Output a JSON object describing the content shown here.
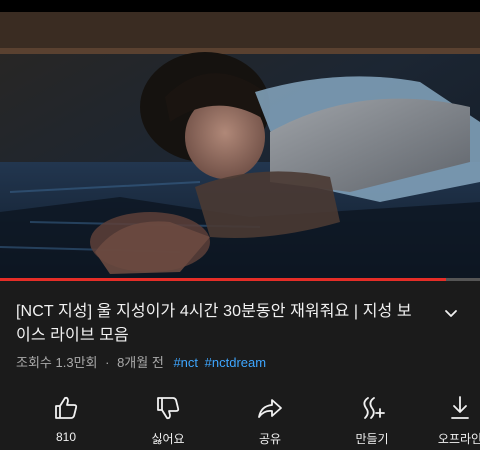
{
  "video": {
    "progress_fraction": 0.93
  },
  "title": "[NCT 지성] 울 지성이가 4시간 30분동안 재워줘요 | 지성 보이스 라이브 모음",
  "meta": {
    "views": "조회수 1.3만회",
    "separator": "·",
    "age": "8개월 전",
    "tags": [
      "#nct",
      "#nctdream"
    ]
  },
  "actions": [
    {
      "icon": "thumbs-up-icon",
      "label": "810"
    },
    {
      "icon": "thumbs-down-icon",
      "label": "싫어요"
    },
    {
      "icon": "share-icon",
      "label": "공유"
    },
    {
      "icon": "remix-icon",
      "label": "만들기"
    },
    {
      "icon": "download-icon",
      "label": "오프라인"
    }
  ]
}
